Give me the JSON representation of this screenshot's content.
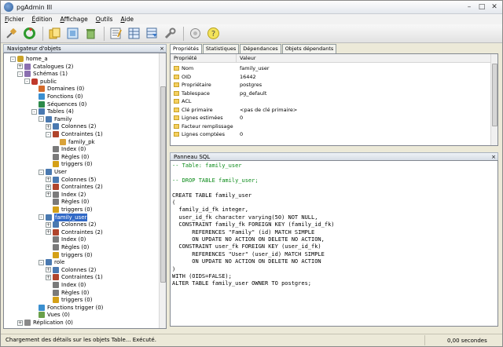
{
  "window": {
    "title": "pgAdmin III",
    "controls": [
      "minimize-icon",
      "maximize-icon",
      "close-icon"
    ]
  },
  "menu": [
    {
      "accel": "F",
      "rest": "ichier"
    },
    {
      "accel": "É",
      "rest": "dition"
    },
    {
      "accel": "A",
      "rest": "ffichage"
    },
    {
      "accel": "O",
      "rest": "utils"
    },
    {
      "accel": "A",
      "rest": "ide"
    }
  ],
  "toolbar": {
    "icons": [
      "connect-icon",
      "refresh-icon",
      "copy-icon",
      "properties-icon",
      "trash-icon",
      "sql-query-icon",
      "view-data-icon",
      "filter-data-icon",
      "maintenance-icon",
      "plugin-icon",
      "help-icon"
    ]
  },
  "browser": {
    "title": "Navigateur d'objets",
    "close": "×",
    "tree": [
      {
        "label": "home_a",
        "depth": 2,
        "exp": "-",
        "icon": "database-icon",
        "selected": false
      },
      {
        "label": "Catalogues (2)",
        "depth": 3,
        "exp": "+",
        "icon": "catalog-icon",
        "selected": false
      },
      {
        "label": "Schémas (1)",
        "depth": 3,
        "exp": "-",
        "icon": "schemas-icon",
        "selected": false
      },
      {
        "label": "public",
        "depth": 4,
        "exp": "-",
        "icon": "schema-icon",
        "selected": false
      },
      {
        "label": "Domaines (0)",
        "depth": 5,
        "exp": "",
        "icon": "domain-icon",
        "selected": false
      },
      {
        "label": "Fonctions (0)",
        "depth": 5,
        "exp": "",
        "icon": "function-icon",
        "selected": false
      },
      {
        "label": "Séquences (0)",
        "depth": 5,
        "exp": "",
        "icon": "sequence-icon",
        "selected": false
      },
      {
        "label": "Tables (4)",
        "depth": 5,
        "exp": "-",
        "icon": "tables-icon",
        "selected": false
      },
      {
        "label": "Family",
        "depth": 6,
        "exp": "-",
        "icon": "table-icon",
        "selected": false
      },
      {
        "label": "Colonnes (2)",
        "depth": 7,
        "exp": "+",
        "icon": "columns-icon",
        "selected": false
      },
      {
        "label": "Contraintes (1)",
        "depth": 7,
        "exp": "-",
        "icon": "constraints-icon",
        "selected": false
      },
      {
        "label": "family_pk",
        "depth": 8,
        "exp": "",
        "icon": "key-icon",
        "selected": false
      },
      {
        "label": "Index (0)",
        "depth": 7,
        "exp": "",
        "icon": "index-icon",
        "selected": false
      },
      {
        "label": "Règles (0)",
        "depth": 7,
        "exp": "",
        "icon": "rules-icon",
        "selected": false
      },
      {
        "label": "triggers (0)",
        "depth": 7,
        "exp": "",
        "icon": "trigger-icon",
        "selected": false
      },
      {
        "label": "User",
        "depth": 6,
        "exp": "-",
        "icon": "table-icon",
        "selected": false
      },
      {
        "label": "Colonnes (5)",
        "depth": 7,
        "exp": "+",
        "icon": "columns-icon",
        "selected": false
      },
      {
        "label": "Contraintes (2)",
        "depth": 7,
        "exp": "+",
        "icon": "constraints-icon",
        "selected": false
      },
      {
        "label": "Index (2)",
        "depth": 7,
        "exp": "+",
        "icon": "index-icon",
        "selected": false
      },
      {
        "label": "Règles (0)",
        "depth": 7,
        "exp": "",
        "icon": "rules-icon",
        "selected": false
      },
      {
        "label": "triggers (0)",
        "depth": 7,
        "exp": "",
        "icon": "trigger-icon",
        "selected": false
      },
      {
        "label": "family_user",
        "depth": 6,
        "exp": "-",
        "icon": "table-icon",
        "selected": true
      },
      {
        "label": "Colonnes (2)",
        "depth": 7,
        "exp": "+",
        "icon": "columns-icon",
        "selected": false
      },
      {
        "label": "Contraintes (2)",
        "depth": 7,
        "exp": "+",
        "icon": "constraints-icon",
        "selected": false
      },
      {
        "label": "Index (0)",
        "depth": 7,
        "exp": "",
        "icon": "index-icon",
        "selected": false
      },
      {
        "label": "Règles (0)",
        "depth": 7,
        "exp": "",
        "icon": "rules-icon",
        "selected": false
      },
      {
        "label": "triggers (0)",
        "depth": 7,
        "exp": "",
        "icon": "trigger-icon",
        "selected": false
      },
      {
        "label": "role",
        "depth": 6,
        "exp": "-",
        "icon": "table-icon",
        "selected": false
      },
      {
        "label": "Colonnes (2)",
        "depth": 7,
        "exp": "+",
        "icon": "columns-icon",
        "selected": false
      },
      {
        "label": "Contraintes (1)",
        "depth": 7,
        "exp": "+",
        "icon": "constraints-icon",
        "selected": false
      },
      {
        "label": "Index (0)",
        "depth": 7,
        "exp": "",
        "icon": "index-icon",
        "selected": false
      },
      {
        "label": "Règles (0)",
        "depth": 7,
        "exp": "",
        "icon": "rules-icon",
        "selected": false
      },
      {
        "label": "triggers (0)",
        "depth": 7,
        "exp": "",
        "icon": "trigger-icon",
        "selected": false
      },
      {
        "label": "Fonctions trigger (0)",
        "depth": 5,
        "exp": "",
        "icon": "function-icon",
        "selected": false
      },
      {
        "label": "Vues (0)",
        "depth": 5,
        "exp": "",
        "icon": "view-icon",
        "selected": false
      },
      {
        "label": "Réplication (0)",
        "depth": 3,
        "exp": "+",
        "icon": "replication-icon",
        "selected": false
      }
    ]
  },
  "tabs": [
    "Propriétés",
    "Statistiques",
    "Dépendances",
    "Objets dépendants"
  ],
  "properties": {
    "headers": [
      "Propriété",
      "Valeur"
    ],
    "rows": [
      [
        "Nom",
        "family_user"
      ],
      [
        "OID",
        "16442"
      ],
      [
        "Propriétaire",
        "postgres"
      ],
      [
        "Tablespace",
        "pg_default"
      ],
      [
        "ACL",
        ""
      ],
      [
        "Clé primaire",
        "<pas de clé primaire>"
      ],
      [
        "Lignes estimées",
        "0"
      ],
      [
        "Facteur remplissage",
        ""
      ],
      [
        "Lignes comptées",
        "0"
      ]
    ]
  },
  "sql": {
    "title": "Panneau SQL",
    "close": "×",
    "lines": [
      {
        "text": "-- Table: family_user",
        "comment": true
      },
      {
        "text": "",
        "comment": false
      },
      {
        "text": "-- DROP TABLE family_user;",
        "comment": true
      },
      {
        "text": "",
        "comment": false
      },
      {
        "text": "CREATE TABLE family_user",
        "comment": false
      },
      {
        "text": "(",
        "comment": false
      },
      {
        "text": "  family_id_fk integer,",
        "comment": false
      },
      {
        "text": "  user_id_fk character varying(50) NOT NULL,",
        "comment": false
      },
      {
        "text": "  CONSTRAINT family_fk FOREIGN KEY (family_id_fk)",
        "comment": false
      },
      {
        "text": "      REFERENCES \"Family\" (id) MATCH SIMPLE",
        "comment": false
      },
      {
        "text": "      ON UPDATE NO ACTION ON DELETE NO ACTION,",
        "comment": false
      },
      {
        "text": "  CONSTRAINT user_fk FOREIGN KEY (user_id_fk)",
        "comment": false
      },
      {
        "text": "      REFERENCES \"User\" (user_id) MATCH SIMPLE",
        "comment": false
      },
      {
        "text": "      ON UPDATE NO ACTION ON DELETE NO ACTION",
        "comment": false
      },
      {
        "text": ")",
        "comment": false
      },
      {
        "text": "WITH (OIDS=FALSE);",
        "comment": false
      },
      {
        "text": "ALTER TABLE family_user OWNER TO postgres;",
        "comment": false
      }
    ]
  },
  "status": {
    "message": "Chargement des détails sur les objets Table... Exécuté.",
    "time": "0,00 secondes"
  },
  "colors": {
    "selection": "#3169c6",
    "comment": "#0a8a18",
    "folder": "#f5d061"
  }
}
